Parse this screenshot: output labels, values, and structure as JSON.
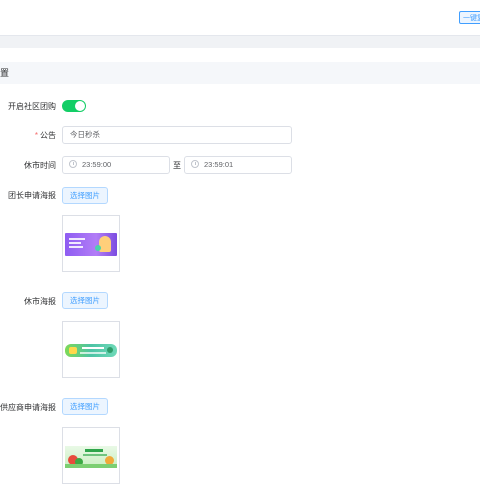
{
  "topbar": {
    "action_button": "一键复制"
  },
  "section": {
    "title": "置"
  },
  "form": {
    "enable_label": "开启社区团购",
    "enable_value": true,
    "notice_label": "公告",
    "notice_required_mark": "*",
    "notice_value": "今日秒杀",
    "closed_label": "休市时间",
    "closed_start": "23:59:00",
    "closed_separator": "至",
    "closed_end": "23:59:01",
    "leader_poster_label": "团长申请海报",
    "closed_poster_label": "休市海报",
    "supplier_poster_label": "供应商申请海报",
    "choose_image_label": "选择图片"
  },
  "colors": {
    "accent": "#409eff",
    "switch_on": "#13ce66",
    "required": "#f56c6c"
  }
}
